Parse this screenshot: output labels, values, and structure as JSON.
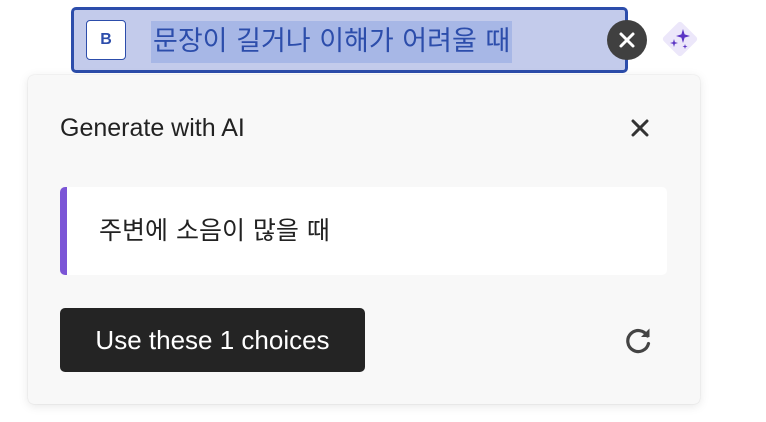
{
  "option": {
    "badge": "B",
    "text": "문장이 길거나 이해가 어려울 때",
    "remove_icon": "close-circle-icon",
    "ai_icon": "sparkle-icon"
  },
  "panel": {
    "title": "Generate with AI",
    "close_icon": "close-icon",
    "choices": [
      "주변에 소음이 많을 때"
    ],
    "use_button_label": "Use these 1 choices",
    "refresh_icon": "refresh-icon"
  },
  "colors": {
    "selection_border": "#2c4dab",
    "selection_background": "#c3cbeb",
    "accent_purple": "#7b55d6",
    "button_dark": "#242424"
  }
}
